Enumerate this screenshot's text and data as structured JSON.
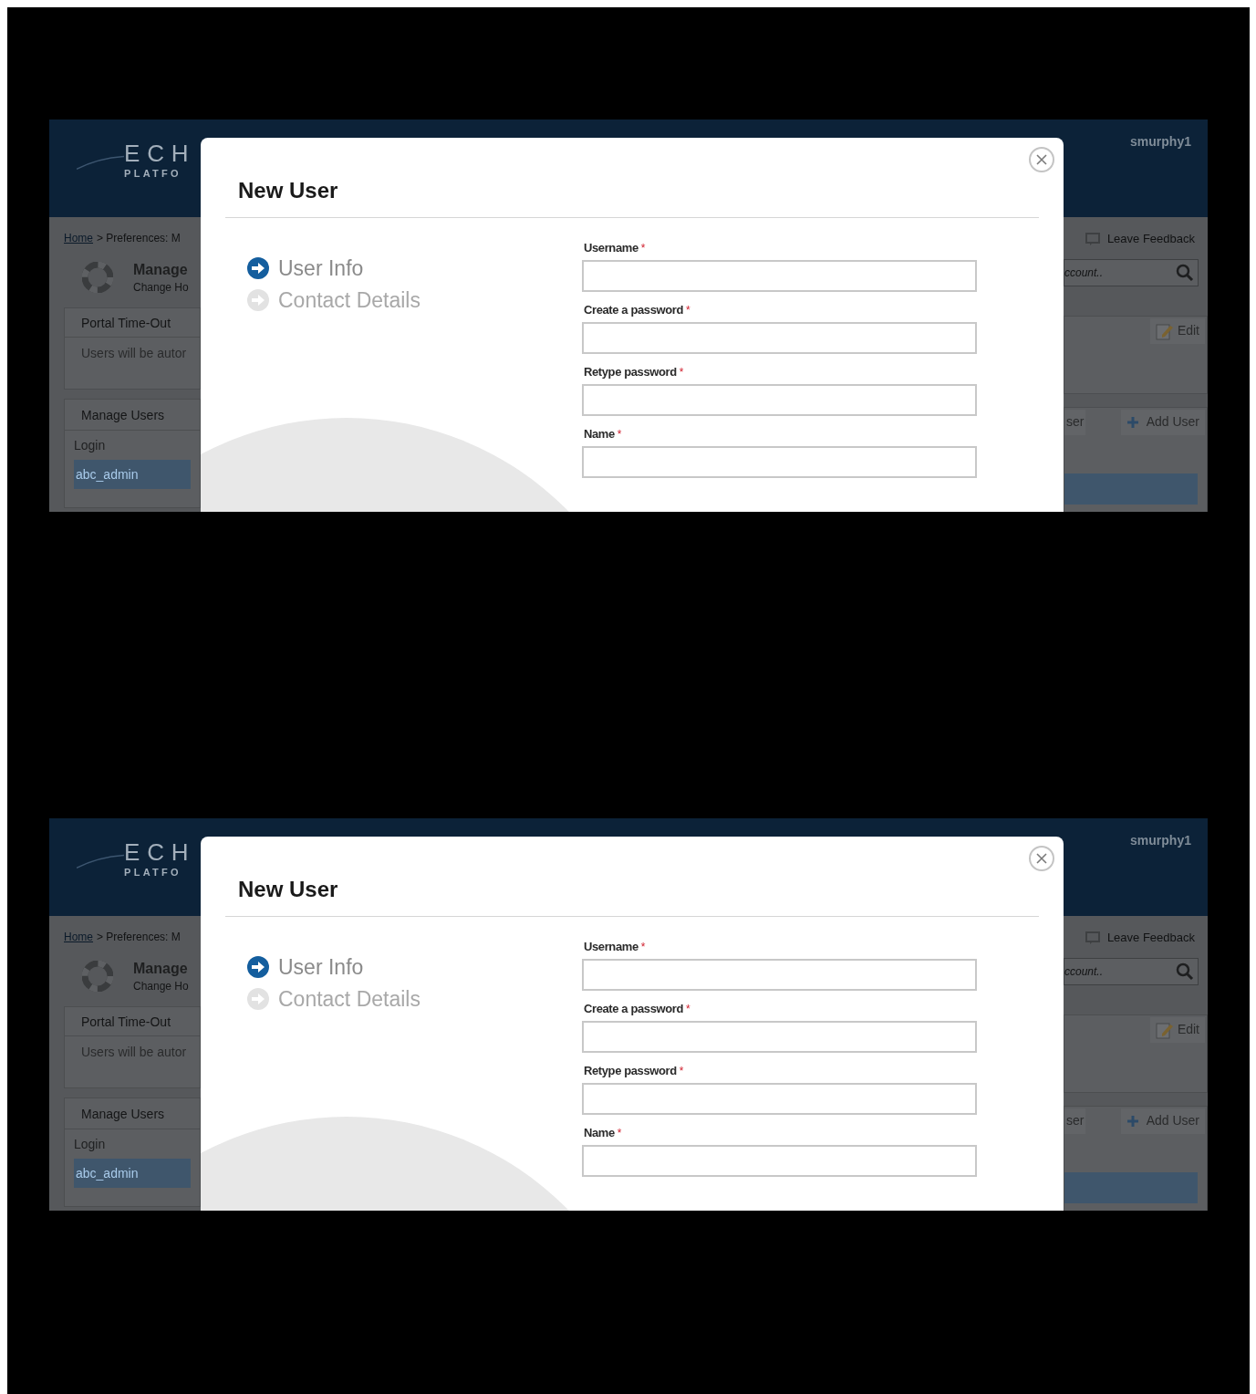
{
  "panels": [
    {
      "app": {
        "logo": {
          "line1": "ECH",
          "line2": "PLATFO"
        },
        "user": "smurphy1",
        "breadcrumb": {
          "link": "Home",
          "rest": "> Preferences: M"
        },
        "page_title": "Manage",
        "page_subtitle": "Change Ho",
        "feedback": "Leave Feedback",
        "search": {
          "placeholder": "ccount.."
        },
        "sections": [
          {
            "title": "Portal Time-Out",
            "text": "Users will be autor",
            "button": "Edit"
          },
          {
            "title": "Manage Users",
            "buttons": [
              "ser",
              "Add User"
            ],
            "column": "Login",
            "rows": [
              {
                "login": "abc_admin",
                "selected": true
              }
            ]
          }
        ]
      },
      "dialog": {
        "title": "New User",
        "steps": [
          {
            "label": "User Info",
            "selected": true
          },
          {
            "label": "Contact Details",
            "selected": false
          }
        ],
        "fields": [
          {
            "label": "Username",
            "required_mark": "*"
          },
          {
            "label": "Create a password",
            "required_mark": "*"
          },
          {
            "label": "Retype password",
            "required_mark": "*"
          },
          {
            "label": "Name",
            "required_mark": "*"
          }
        ]
      }
    },
    {
      "app": {
        "logo": {
          "line1": "ECH",
          "line2": "PLATFO"
        },
        "user": "smurphy1",
        "breadcrumb": {
          "link": "Home",
          "rest": "> Preferences: M"
        },
        "page_title": "Manage",
        "page_subtitle": "Change Ho",
        "feedback": "Leave Feedback",
        "search": {
          "placeholder": "ccount.."
        },
        "sections": [
          {
            "title": "Portal Time-Out",
            "text": "Users will be autor",
            "button": "Edit"
          },
          {
            "title": "Manage Users",
            "buttons": [
              "ser",
              "Add User"
            ],
            "column": "Login",
            "rows": [
              {
                "login": "abc_admin",
                "selected": true
              }
            ]
          }
        ]
      },
      "dialog": {
        "title": "New User",
        "steps": [
          {
            "label": "User Info",
            "selected": true
          },
          {
            "label": "Contact Details",
            "selected": false
          }
        ],
        "fields": [
          {
            "label": "Username",
            "required_mark": "*"
          },
          {
            "label": "Create a password",
            "required_mark": "*"
          },
          {
            "label": "Retype password",
            "required_mark": "*"
          },
          {
            "label": "Name",
            "required_mark": "*"
          }
        ]
      }
    }
  ]
}
